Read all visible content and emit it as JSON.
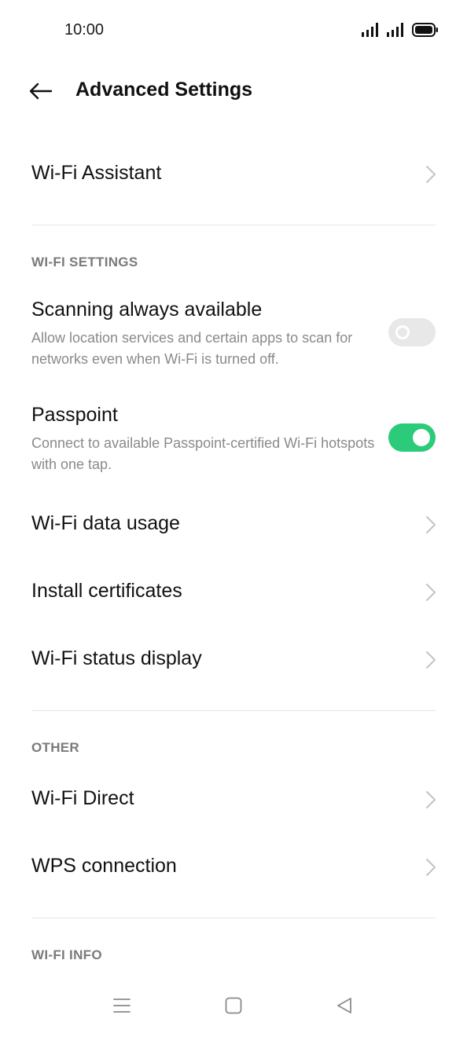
{
  "status_bar": {
    "time": "10:00",
    "icons": [
      "signal-icon",
      "signal-icon",
      "battery-icon"
    ]
  },
  "header": {
    "back_icon": "arrow-left-icon",
    "title": "Advanced Settings"
  },
  "rows": {
    "wifi_assistant": {
      "title": "Wi-Fi Assistant"
    },
    "scanning": {
      "title": "Scanning always available",
      "subtitle": "Allow location services and certain apps to scan for networks even when Wi-Fi is turned off.",
      "enabled": false
    },
    "passpoint": {
      "title": "Passpoint",
      "subtitle": "Connect to available Passpoint-certified Wi-Fi hotspots with one tap.",
      "enabled": true
    },
    "wifi_data_usage": {
      "title": "Wi-Fi data usage"
    },
    "install_certificates": {
      "title": "Install certificates"
    },
    "wifi_status_display": {
      "title": "Wi-Fi status display"
    },
    "wifi_direct": {
      "title": "Wi-Fi Direct"
    },
    "wps_connection": {
      "title": "WPS connection"
    }
  },
  "sections": {
    "wifi_settings": "WI-FI SETTINGS",
    "other": "OTHER",
    "wifi_info": "WI-FI INFO"
  },
  "nav_bar": {
    "icons": [
      "menu-icon",
      "home-square-icon",
      "back-triangle-icon"
    ]
  },
  "colors": {
    "toggle_on": "#2bcb7a",
    "toggle_off": "#e8e8e8",
    "secondary_text": "#8a8a8a",
    "section_text": "#7a7a7a"
  }
}
